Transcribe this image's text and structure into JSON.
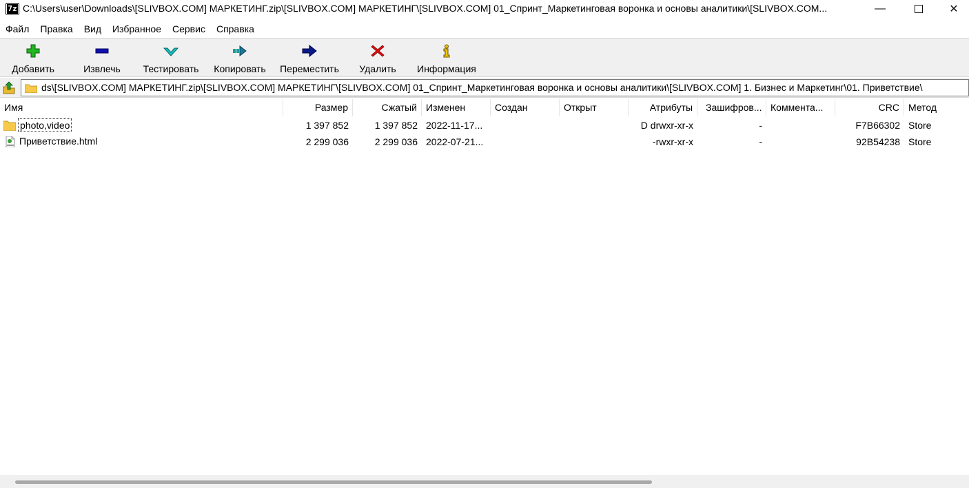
{
  "window": {
    "title": "C:\\Users\\user\\Downloads\\[SLIVBOX.COM] МАРКЕТИНГ.zip\\[SLIVBOX.COM] МАРКЕТИНГ\\[SLIVBOX.COM] 01_Спринт_Маркетинговая воронка и основы аналитики\\[SLIVBOX.COM...",
    "app_icon_text": "7z",
    "minimize": "—",
    "close": "✕"
  },
  "menu": [
    "Файл",
    "Правка",
    "Вид",
    "Избранное",
    "Сервис",
    "Справка"
  ],
  "toolbar": {
    "add": "Добавить",
    "extract": "Извлечь",
    "test": "Тестировать",
    "copy": "Копировать",
    "move": "Переместить",
    "delete": "Удалить",
    "info": "Информация"
  },
  "address": {
    "path": "ds\\[SLIVBOX.COM] МАРКЕТИНГ.zip\\[SLIVBOX.COM] МАРКЕТИНГ\\[SLIVBOX.COM] 01_Спринт_Маркетинговая воронка и основы аналитики\\[SLIVBOX.COM] 1. Бизнес и Маркетинг\\01. Приветствие\\"
  },
  "columns": {
    "name": "Имя",
    "size": "Размер",
    "packed": "Сжатый",
    "modified": "Изменен",
    "created": "Создан",
    "accessed": "Открыт",
    "attributes": "Атрибуты",
    "encrypted": "Зашифров...",
    "comment": "Коммента...",
    "crc": "CRC",
    "method": "Метод"
  },
  "rows": [
    {
      "name": "photo,video",
      "icon": "folder-icon",
      "size": "1 397 852",
      "packed": "1 397 852",
      "modified": "2022-11-17...",
      "created": "",
      "accessed": "",
      "attributes": "D drwxr-xr-x",
      "encrypted": "-",
      "comment": "",
      "crc": "F7B66302",
      "method": "Store"
    },
    {
      "name": "Приветствие.html",
      "icon": "html-file-icon",
      "size": "2 299 036",
      "packed": "2 299 036",
      "modified": "2022-07-21...",
      "created": "",
      "accessed": "",
      "attributes": "-rwxr-xr-x",
      "encrypted": "-",
      "comment": "",
      "crc": "92B54238",
      "method": "Store"
    }
  ],
  "colors": {
    "add_green": "#22b822",
    "extract_blue": "#1010b0",
    "test_teal": "#16c0c0",
    "delete_red": "#e01010",
    "info_yellow": "#f2c400",
    "folder_yellow": "#f6c94a"
  }
}
